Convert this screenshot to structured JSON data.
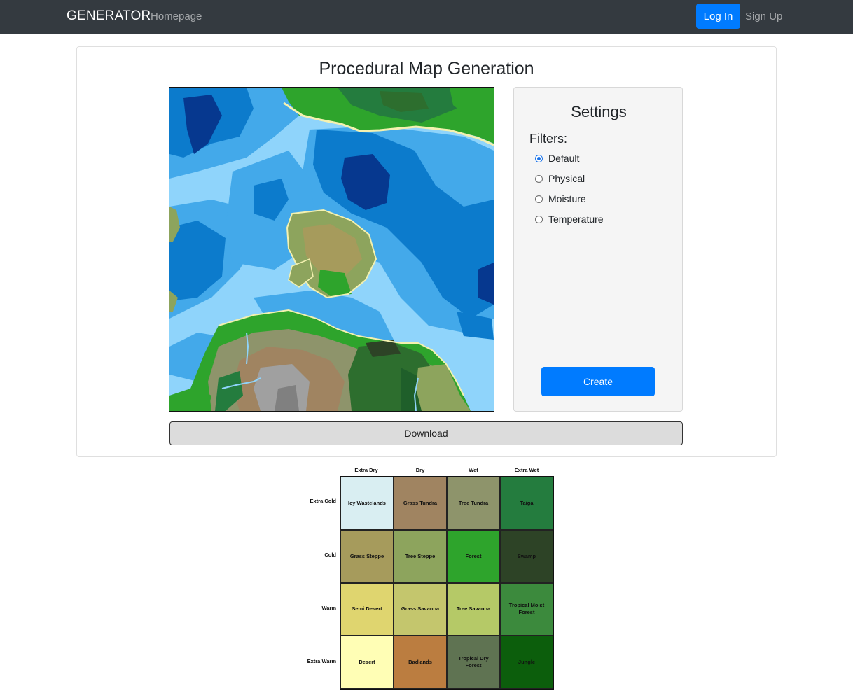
{
  "navbar": {
    "brand": "GENERATOR",
    "home_link": "Homepage",
    "login_label": "Log In",
    "signup_label": "Sign Up"
  },
  "main": {
    "title": "Procedural Map Generation",
    "download_label": "Download"
  },
  "settings": {
    "title": "Settings",
    "filters_label": "Filters:",
    "filters": [
      {
        "label": "Default",
        "checked": true
      },
      {
        "label": "Physical",
        "checked": false
      },
      {
        "label": "Moisture",
        "checked": false
      },
      {
        "label": "Temperature",
        "checked": false
      }
    ],
    "create_label": "Create"
  },
  "legend": {
    "columns": [
      "Extra Dry",
      "Dry",
      "Wet",
      "Extra Wet"
    ],
    "rows": [
      "Extra Cold",
      "Cold",
      "Warm",
      "Extra Warm"
    ],
    "cells": [
      [
        {
          "label": "Icy Wastelands",
          "color": "#d9eef2"
        },
        {
          "label": "Grass Tundra",
          "color": "#a08461"
        },
        {
          "label": "Tree Tundra",
          "color": "#8e946b"
        },
        {
          "label": "Taiga",
          "color": "#247c3e"
        }
      ],
      [
        {
          "label": "Grass Steppe",
          "color": "#a69b5c"
        },
        {
          "label": "Tree Steppe",
          "color": "#8da45d"
        },
        {
          "label": "Forest",
          "color": "#2ea42c"
        },
        {
          "label": "Swamp",
          "color": "#2d4326"
        }
      ],
      [
        {
          "label": "Semi Desert",
          "color": "#dfd56f"
        },
        {
          "label": "Grass Savanna",
          "color": "#c4c66d"
        },
        {
          "label": "Tree Savanna",
          "color": "#b5c967"
        },
        {
          "label": "Tropical Moist Forest",
          "color": "#3c8a3d"
        }
      ],
      [
        {
          "label": "Desert",
          "color": "#fffeb5"
        },
        {
          "label": "Badlands",
          "color": "#bb7d40"
        },
        {
          "label": "Tropical Dry Forest",
          "color": "#5f7352"
        },
        {
          "label": "Jungle",
          "color": "#0c5e0c"
        }
      ]
    ]
  }
}
